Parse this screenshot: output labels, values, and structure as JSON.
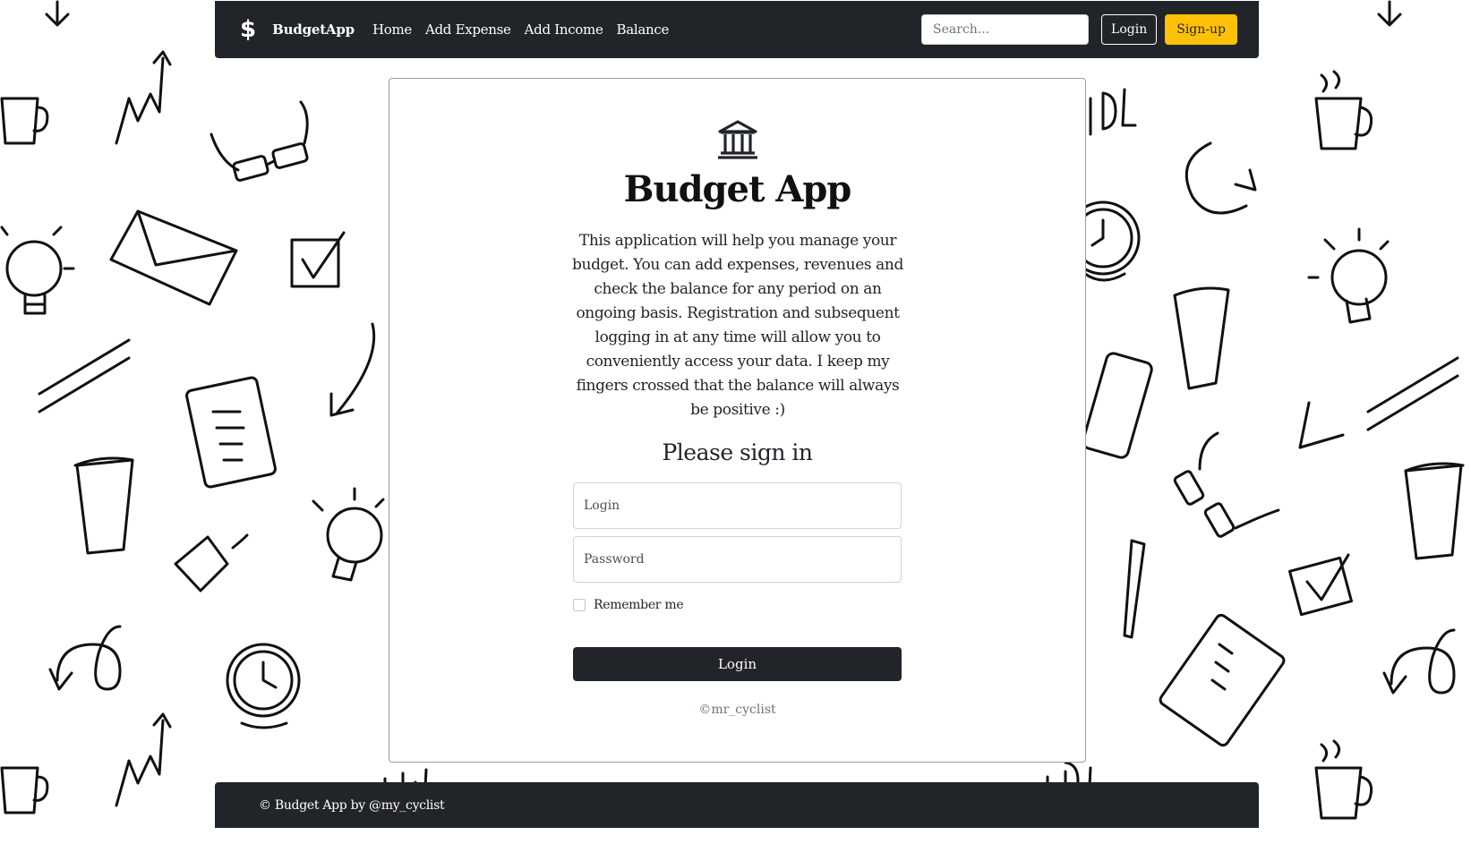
{
  "navbar": {
    "brand_icon": "dollar-icon",
    "brand_symbol": "$",
    "brand": "BudgetApp",
    "links": [
      {
        "label": "Home"
      },
      {
        "label": "Add Expense"
      },
      {
        "label": "Add Income"
      },
      {
        "label": "Balance"
      }
    ],
    "search_placeholder": "Search...",
    "login_label": "Login",
    "signup_label": "Sign-up"
  },
  "card": {
    "icon": "bank-icon",
    "title": "Budget App",
    "description": "This application will help you manage your budget. You can add expenses, revenues and check the balance for any period on an ongoing basis. Registration and subsequent logging in at any time will allow you to conveniently access your data. I keep my fingers crossed that the balance will always be positive :)",
    "signin_heading": "Please sign in",
    "login_placeholder": "Login",
    "password_placeholder": "Password",
    "remember_label": "Remember me",
    "remember_checked": false,
    "submit_label": "Login",
    "copyright": "©mr_cyclist"
  },
  "footer": {
    "text": "© Budget App by @my_cyclist"
  },
  "colors": {
    "dark": "#212529",
    "accent": "#ffc107",
    "background": "#ffffff"
  }
}
